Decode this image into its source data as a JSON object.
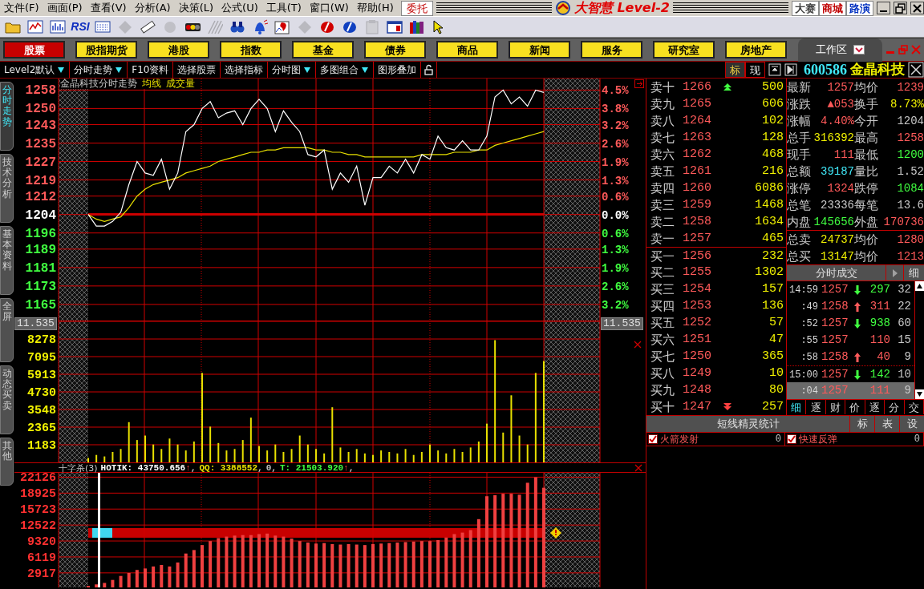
{
  "menu": [
    "文件(F)",
    "画面(P)",
    "查看(V)",
    "分析(A)",
    "决策(L)",
    "公式(U)",
    "工具(T)",
    "窗口(W)",
    "帮助(H)"
  ],
  "trade_button": "委托",
  "app_title": {
    "name": "大智慧",
    "edition": "Level-2"
  },
  "top_links": [
    {
      "label": "大赛",
      "color": "#404040"
    },
    {
      "label": "商城",
      "color": "#c00000"
    },
    {
      "label": "路演",
      "color": "#0030c0"
    }
  ],
  "toolbar": [
    {
      "kind": "folder",
      "disabled": false
    },
    {
      "kind": "line-chart",
      "disabled": false
    },
    {
      "kind": "bar-chart",
      "disabled": false
    },
    {
      "kind": "text",
      "label": "RSI",
      "disabled": false
    },
    {
      "kind": "ticker",
      "disabled": false
    },
    {
      "kind": "move",
      "disabled": true
    },
    {
      "kind": "ruler",
      "disabled": false
    },
    {
      "kind": "coin",
      "disabled": true
    },
    {
      "kind": "lights",
      "disabled": false
    },
    {
      "kind": "hatch",
      "disabled": true
    },
    {
      "kind": "binoculars",
      "disabled": false
    },
    {
      "kind": "bell",
      "disabled": false
    },
    {
      "kind": "chart-alert",
      "disabled": false
    },
    {
      "kind": "move",
      "disabled": true
    },
    {
      "kind": "red-logo",
      "disabled": false
    },
    {
      "kind": "blue-logo",
      "disabled": false
    },
    {
      "kind": "clipboard",
      "disabled": true
    },
    {
      "kind": "window",
      "disabled": false
    },
    {
      "kind": "books",
      "disabled": false
    },
    {
      "kind": "pointer",
      "disabled": false
    }
  ],
  "market_tabs": [
    {
      "label": "股票",
      "selected": true
    },
    {
      "label": "股指期货",
      "selected": false
    },
    {
      "label": "港股",
      "selected": false
    },
    {
      "label": "指数",
      "selected": false
    },
    {
      "label": "基金",
      "selected": false
    },
    {
      "label": "债券",
      "selected": false
    },
    {
      "label": "商品",
      "selected": false
    },
    {
      "label": "新闻",
      "selected": false
    },
    {
      "label": "服务",
      "selected": false
    },
    {
      "label": "研究室",
      "selected": false
    },
    {
      "label": "房地产",
      "selected": false
    }
  ],
  "workspace": {
    "label": "工作区"
  },
  "function_bar": [
    {
      "label": "Level2默认",
      "dropdown": true
    },
    {
      "label": "分时走势",
      "dropdown": true
    },
    {
      "label": "F10资料",
      "dropdown": false
    },
    {
      "label": "选择股票",
      "dropdown": false
    },
    {
      "label": "选择指标",
      "dropdown": false
    },
    {
      "label": "分时图",
      "dropdown": true
    },
    {
      "label": "多图组合",
      "dropdown": true
    },
    {
      "label": "图形叠加",
      "dropdown": false
    }
  ],
  "view_buttons": [
    {
      "label": "标",
      "selected": true
    },
    {
      "label": "现",
      "selected": false
    }
  ],
  "stock": {
    "code": "600586",
    "name": "金晶科技"
  },
  "side_tabs": [
    {
      "label": "分时走势",
      "selected": true
    },
    {
      "label": "技术分析",
      "selected": false
    },
    {
      "label": "基本资料",
      "selected": false
    },
    {
      "label": "全屏",
      "selected": false
    },
    {
      "label": "动态买卖",
      "selected": false
    },
    {
      "label": "其他",
      "selected": false
    }
  ],
  "chart_title": "金晶科技分时走势",
  "price_chart": {
    "chart_data": {
      "type": "line",
      "ylim": [
        1158,
        1263
      ],
      "grid": true,
      "yticks": [
        {
          "value": 1258,
          "label": "1258"
        },
        {
          "value": 1250,
          "label": "1250"
        },
        {
          "value": 1243,
          "label": "1243"
        },
        {
          "value": 1235,
          "label": "1235"
        },
        {
          "value": 1227,
          "label": "1227"
        },
        {
          "value": 1219,
          "label": "1219"
        },
        {
          "value": 1212,
          "label": "1212"
        },
        {
          "value": 1204,
          "label": "1204"
        },
        {
          "value": 1196,
          "label": "1196"
        },
        {
          "value": 1189,
          "label": "1189"
        },
        {
          "value": 1181,
          "label": "1181"
        },
        {
          "value": 1173,
          "label": "1173"
        },
        {
          "value": 1165,
          "label": "1165"
        }
      ],
      "series": [
        {
          "color": "#ffffff",
          "values": [
            1204,
            1199,
            1199,
            1201,
            1205,
            1217,
            1227,
            1222,
            1221,
            1228,
            1215,
            1222,
            1240,
            1243,
            1250,
            1253,
            1246,
            1248,
            1249,
            1243,
            1250,
            1254,
            1250,
            1240,
            1249,
            1244,
            1240,
            1230,
            1229,
            1232,
            1215,
            1222,
            1218,
            1225,
            1208,
            1220,
            1220,
            1225,
            1222,
            1228,
            1222,
            1230,
            1228,
            1238,
            1233,
            1232,
            1236,
            1232,
            1232,
            1238,
            1255,
            1258,
            1252,
            1255,
            1251,
            1258,
            1257
          ]
        },
        {
          "name": "均线",
          "color": "#e8e000",
          "values": [
            1204,
            1202,
            1201,
            1202,
            1203,
            1207,
            1212,
            1215,
            1217,
            1218,
            1219,
            1220,
            1222,
            1223,
            1224,
            1225,
            1227,
            1228,
            1229,
            1230,
            1231,
            1231,
            1232,
            1232,
            1233,
            1233,
            1233,
            1233,
            1232,
            1232,
            1231,
            1231,
            1230,
            1230,
            1229,
            1229,
            1229,
            1229,
            1229,
            1229,
            1229,
            1230,
            1230,
            1230,
            1230,
            1231,
            1231,
            1231,
            1232,
            1232,
            1234,
            1235,
            1236,
            1237,
            1238,
            1239,
            1240
          ]
        }
      ]
    },
    "percent_labels": [
      {
        "label": "4.5%",
        "color": "#ff5a5a"
      },
      {
        "label": "3.8%",
        "color": "#ff5a5a"
      },
      {
        "label": "3.2%",
        "color": "#ff5a5a"
      },
      {
        "label": "2.6%",
        "color": "#ff5a5a"
      },
      {
        "label": "1.9%",
        "color": "#ff5a5a"
      },
      {
        "label": "1.3%",
        "color": "#ff5a5a"
      },
      {
        "label": "0.6%",
        "color": "#ff5a5a"
      },
      {
        "label": "0.0%",
        "color": "#ffffff"
      },
      {
        "label": "0.6%",
        "color": "#40ff40"
      },
      {
        "label": "1.3%",
        "color": "#40ff40"
      },
      {
        "label": "1.9%",
        "color": "#40ff40"
      },
      {
        "label": "2.6%",
        "color": "#40ff40"
      },
      {
        "label": "3.2%",
        "color": "#40ff40"
      }
    ]
  },
  "cursor_readouts": [
    "11.535",
    "11.535"
  ],
  "volume_chart": {
    "chart_data": {
      "type": "bar",
      "title": "成交量",
      "ylim": [
        0,
        9516
      ],
      "grid": true,
      "yticks": [
        {
          "value": 8278,
          "label": "8278"
        },
        {
          "value": 7095,
          "label": "7095"
        },
        {
          "value": 5913,
          "label": "5913"
        },
        {
          "value": 4730,
          "label": "4730"
        },
        {
          "value": 3548,
          "label": "3548"
        },
        {
          "value": 2365,
          "label": "2365"
        },
        {
          "value": 1183,
          "label": "1183"
        }
      ],
      "series": [
        {
          "color": "#e8e000",
          "values": [
            300,
            500,
            400,
            700,
            900,
            2700,
            1500,
            1800,
            1200,
            900,
            1600,
            1200,
            800,
            1400,
            6000,
            2400,
            1300,
            800,
            900,
            1500,
            3000,
            1100,
            800,
            1200,
            700,
            900,
            1800,
            1200,
            900,
            600,
            3700,
            1000,
            700,
            900,
            600,
            500,
            800,
            700,
            600,
            900,
            500,
            700,
            1200,
            800,
            600,
            900,
            700,
            1000,
            1400,
            2600,
            8200,
            2000,
            4500,
            1800,
            1200,
            6000,
            6800
          ]
        }
      ]
    }
  },
  "indicator_chart": {
    "chart_data": {
      "type": "bar",
      "title": "十字杀(3)",
      "ylim": [
        0,
        23000
      ],
      "grid": true,
      "yticks": [
        {
          "value": 22126,
          "label": "22126"
        },
        {
          "value": 18925,
          "label": "18925"
        },
        {
          "value": 15723,
          "label": "15723"
        },
        {
          "value": 12522,
          "label": "12522"
        },
        {
          "value": 9320,
          "label": "9320"
        },
        {
          "value": 6119,
          "label": "6119"
        },
        {
          "value": 2917,
          "label": "2917"
        }
      ],
      "series": [
        {
          "color": "#f04040",
          "values": [
            300,
            600,
            900,
            1500,
            2300,
            2900,
            3500,
            3800,
            4200,
            4500,
            4200,
            5000,
            6800,
            7500,
            8500,
            9300,
            9900,
            10200,
            10400,
            10500,
            10500,
            10700,
            10800,
            10400,
            10200,
            9800,
            9300,
            9000,
            8800,
            8900,
            8700,
            8600,
            8700,
            8600,
            8500,
            8700,
            8800,
            8900,
            9000,
            9100,
            9200,
            9300,
            9300,
            9500,
            10000,
            10700,
            11000,
            11500,
            13700,
            18300,
            18500,
            18800,
            18800,
            18600,
            21000,
            22100,
            20000
          ]
        }
      ]
    },
    "readouts": [
      {
        "text": "HOTIK: 43750.656",
        "color": "#ffffff",
        "arrow": "↑",
        "suffix": ","
      },
      {
        "text": "QQ: 3388552",
        "color": "#e8e000",
        "suffix": ","
      },
      {
        "text": "0",
        "color": "#c0c0c0",
        "suffix": ","
      },
      {
        "text": "T: 21503.920",
        "color": "#40ff40",
        "arrow": "↑",
        "suffix": ","
      }
    ]
  },
  "order_book": {
    "asks": [
      {
        "label": "卖十",
        "price": "1266",
        "volume": "500",
        "arrow": true
      },
      {
        "label": "卖九",
        "price": "1265",
        "volume": "606",
        "arrow": false
      },
      {
        "label": "卖八",
        "price": "1264",
        "volume": "102",
        "arrow": false
      },
      {
        "label": "卖七",
        "price": "1263",
        "volume": "128",
        "arrow": false
      },
      {
        "label": "卖六",
        "price": "1262",
        "volume": "468",
        "arrow": false
      },
      {
        "label": "卖五",
        "price": "1261",
        "volume": "216",
        "arrow": false
      },
      {
        "label": "卖四",
        "price": "1260",
        "volume": "6086",
        "arrow": false
      },
      {
        "label": "卖三",
        "price": "1259",
        "volume": "1468",
        "arrow": false
      },
      {
        "label": "卖二",
        "price": "1258",
        "volume": "1634",
        "arrow": false
      },
      {
        "label": "卖一",
        "price": "1257",
        "volume": "465",
        "arrow": false
      }
    ],
    "bids": [
      {
        "label": "买一",
        "price": "1256",
        "volume": "232",
        "arrow": false
      },
      {
        "label": "买二",
        "price": "1255",
        "volume": "1302",
        "arrow": false
      },
      {
        "label": "买三",
        "price": "1254",
        "volume": "157",
        "arrow": false
      },
      {
        "label": "买四",
        "price": "1253",
        "volume": "136",
        "arrow": false
      },
      {
        "label": "买五",
        "price": "1252",
        "volume": "57",
        "arrow": false
      },
      {
        "label": "买六",
        "price": "1251",
        "volume": "47",
        "arrow": false
      },
      {
        "label": "买七",
        "price": "1250",
        "volume": "365",
        "arrow": false
      },
      {
        "label": "买八",
        "price": "1249",
        "volume": "10",
        "arrow": false
      },
      {
        "label": "买九",
        "price": "1248",
        "volume": "80",
        "arrow": false
      },
      {
        "label": "买十",
        "price": "1247",
        "volume": "257",
        "arrow": true
      }
    ]
  },
  "quote_stats": [
    {
      "label": "最新",
      "value": "1257",
      "color": "#ff5a5a"
    },
    {
      "label": "均价",
      "value": "1239",
      "color": "#ff5a5a"
    },
    {
      "label": "涨跌",
      "value": "▲053",
      "color": "#ff5a5a"
    },
    {
      "label": "换手",
      "value": "8.73%",
      "color": "#f0f000"
    },
    {
      "label": "涨幅",
      "value": "4.40%",
      "color": "#ff5a5a"
    },
    {
      "label": "今开",
      "value": "1204",
      "color": "#c8c8c8"
    },
    {
      "label": "总手",
      "value": "316392",
      "color": "#f0f000"
    },
    {
      "label": "最高",
      "value": "1258",
      "color": "#ff5a5a"
    },
    {
      "label": "现手",
      "value": "111",
      "color": "#ff5a5a"
    },
    {
      "label": "最低",
      "value": "1200",
      "color": "#40ff40"
    },
    {
      "label": "总额",
      "value": "39187",
      "color": "#40e8f8"
    },
    {
      "label": "量比",
      "value": "1.52",
      "color": "#c8c8c8"
    },
    {
      "label": "涨停",
      "value": "1324",
      "color": "#ff5a5a"
    },
    {
      "label": "跌停",
      "value": "1084",
      "color": "#40ff40"
    },
    {
      "label": "总笔",
      "value": "23336",
      "color": "#c8c8c8"
    },
    {
      "label": "每笔",
      "value": "13.6",
      "color": "#c8c8c8"
    },
    {
      "label": "内盘",
      "value": "145656",
      "color": "#40ff40"
    },
    {
      "label": "外盘",
      "value": "170736",
      "color": "#ff5a5a"
    }
  ],
  "order_totals": [
    {
      "label": "总卖",
      "value": "24737",
      "color": "#f0f000"
    },
    {
      "label": "均价",
      "value": "1280",
      "color": "#ff5a5a"
    },
    {
      "label": "总买",
      "value": "13147",
      "color": "#f0f000"
    },
    {
      "label": "均价",
      "value": "1213",
      "color": "#ff5a5a"
    }
  ],
  "trade_panel": {
    "title": "分时成交",
    "detail_button": "细"
  },
  "trades": [
    {
      "time": "14:59",
      "price": "1257",
      "kind": "down",
      "volume": "297",
      "count": "32",
      "selected": false,
      "separator_before": false
    },
    {
      "time": ":49",
      "price": "1258",
      "kind": "up",
      "volume": "311",
      "count": "22",
      "selected": false,
      "separator_before": false
    },
    {
      "time": ":52",
      "price": "1257",
      "kind": "down",
      "volume": "938",
      "count": "60",
      "selected": false,
      "separator_before": false
    },
    {
      "time": ":55",
      "price": "1257",
      "kind": "flat",
      "volume": "110",
      "count": "15",
      "selected": false,
      "separator_before": false
    },
    {
      "time": ":58",
      "price": "1258",
      "kind": "up",
      "volume": "40",
      "count": "9",
      "selected": false,
      "separator_before": false
    },
    {
      "time": "15:00",
      "price": "1257",
      "kind": "down",
      "volume": "142",
      "count": "10",
      "selected": false,
      "separator_before": true
    },
    {
      "time": ":04",
      "price": "1257",
      "kind": "flat",
      "volume": "111",
      "count": "9",
      "selected": true,
      "separator_before": false
    }
  ],
  "trade_tabs": [
    {
      "label": "细",
      "selected": true
    },
    {
      "label": "逐",
      "selected": false
    },
    {
      "label": "财",
      "selected": false
    },
    {
      "label": "价",
      "selected": false
    },
    {
      "label": "逐",
      "selected": false
    },
    {
      "label": "分",
      "selected": false
    },
    {
      "label": "交",
      "selected": false
    }
  ],
  "signal_panel": {
    "title": "短线精灵统计",
    "buttons": [
      "标",
      "表",
      "设"
    ],
    "items": [
      {
        "label": "火箭发射",
        "count": "0",
        "checked": true
      },
      {
        "label": "快速反弹",
        "count": "0",
        "checked": true
      }
    ]
  }
}
